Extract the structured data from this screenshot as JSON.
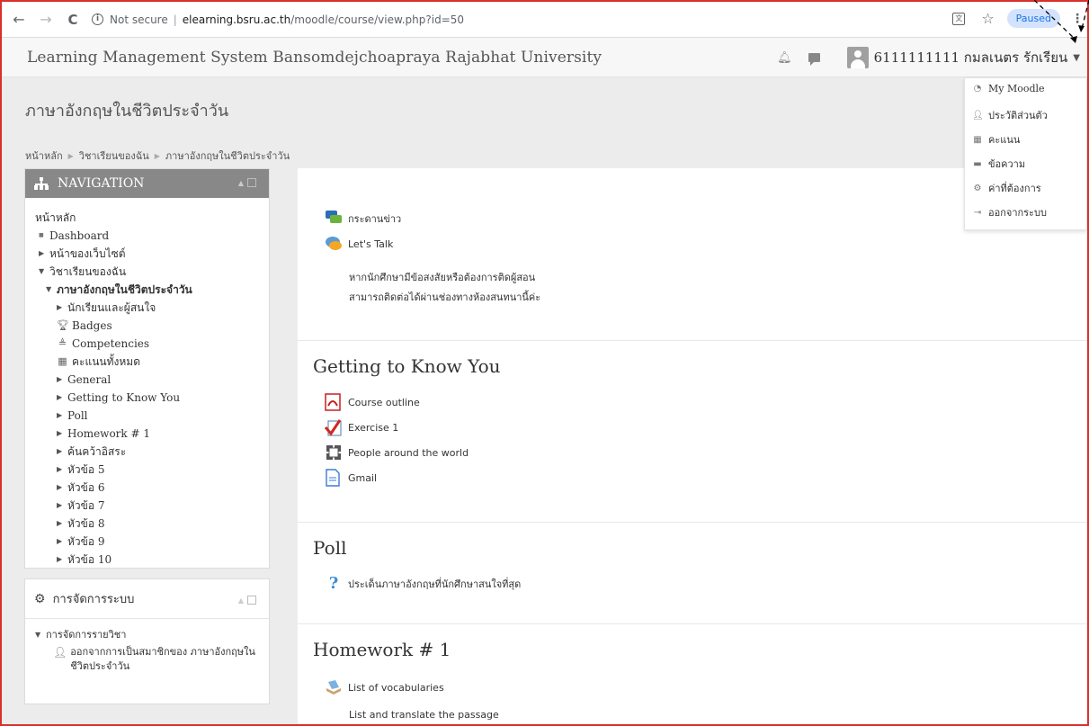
{
  "browser": {
    "security_label": "Not secure",
    "url_host": "elearning.bsru.ac.th",
    "url_path": "/moodle/course/view.php?id=50",
    "paused_label": "Paused"
  },
  "navbar": {
    "site_title": "Learning Management System Bansomdejchoapraya Rajabhat University",
    "user_name": "6111111111 กมลเนตร รักเรียน"
  },
  "user_menu": {
    "items": [
      {
        "label": "My Moodle",
        "icon": "dashboard-icon"
      },
      {
        "label": "ประวัติส่วนตัว",
        "icon": "user-icon"
      },
      {
        "label": "คะแนน",
        "icon": "grades-icon"
      },
      {
        "label": "ข้อความ",
        "icon": "message-icon"
      },
      {
        "label": "ค่าที่ต้องการ",
        "icon": "wrench-icon"
      },
      {
        "label": "ออกจากระบบ",
        "icon": "logout-icon"
      }
    ]
  },
  "course": {
    "title": "ภาษาอังกฤษในชีวิตประจำวัน"
  },
  "breadcrumb": [
    "หน้าหลัก",
    "วิชาเรียนของฉัน",
    "ภาษาอังกฤษในชีวิตประจำวัน"
  ],
  "navigation_block": {
    "title": "NAVIGATION",
    "home": "หน้าหลัก",
    "dashboard": "Dashboard",
    "site_pages": "หน้าของเว็บไซต์",
    "my_courses": "วิชาเรียนของฉัน",
    "current_course": "ภาษาอังกฤษในชีวิตประจำวัน",
    "participants": "นักเรียนและผู้สนใจ",
    "badges": "Badges",
    "competencies": "Competencies",
    "grades": "คะแนนทั้งหมด",
    "sections": [
      "General",
      "Getting to Know You",
      "Poll",
      "Homework # 1",
      "ค้นคว้าอิสระ",
      "หัวข้อ 5",
      "หัวข้อ 6",
      "หัวข้อ 7",
      "หัวข้อ 8",
      "หัวข้อ 9",
      "หัวข้อ 10"
    ]
  },
  "admin_block": {
    "title": "การจัดการระบบ",
    "course_admin": "การจัดการรายวิชา",
    "unenrol_line1": "ออกจากการเป็นสมาชิกของ ภาษาอังกฤษใน",
    "unenrol_line2": "ชีวิตประจำวัน"
  },
  "main": {
    "general": {
      "news": "กระดานข่าว",
      "lets_talk": "Let's Talk",
      "note_line1": "หากนักศึกษามีข้อสงสัยหรือต้องการติดผู้สอน",
      "note_line2": "สามารถติดต่อได้ผ่านช่องทางห้องสนทนานี้ค่ะ"
    },
    "getting_to_know": {
      "title": "Getting to Know You",
      "activities": [
        "Course outline",
        "Exercise 1",
        "People around the world",
        "Gmail"
      ]
    },
    "poll": {
      "title": "Poll",
      "activity": "ประเด็นภาษาอังกฤษที่นักศึกษาสนใจที่สุด"
    },
    "homework": {
      "title": "Homework # 1",
      "activity": "List of vocabularies",
      "text": "List and translate the passage"
    }
  },
  "colors": {
    "frame": "#d9302c",
    "nav_header": "#888888",
    "page_bg": "#ececec"
  }
}
